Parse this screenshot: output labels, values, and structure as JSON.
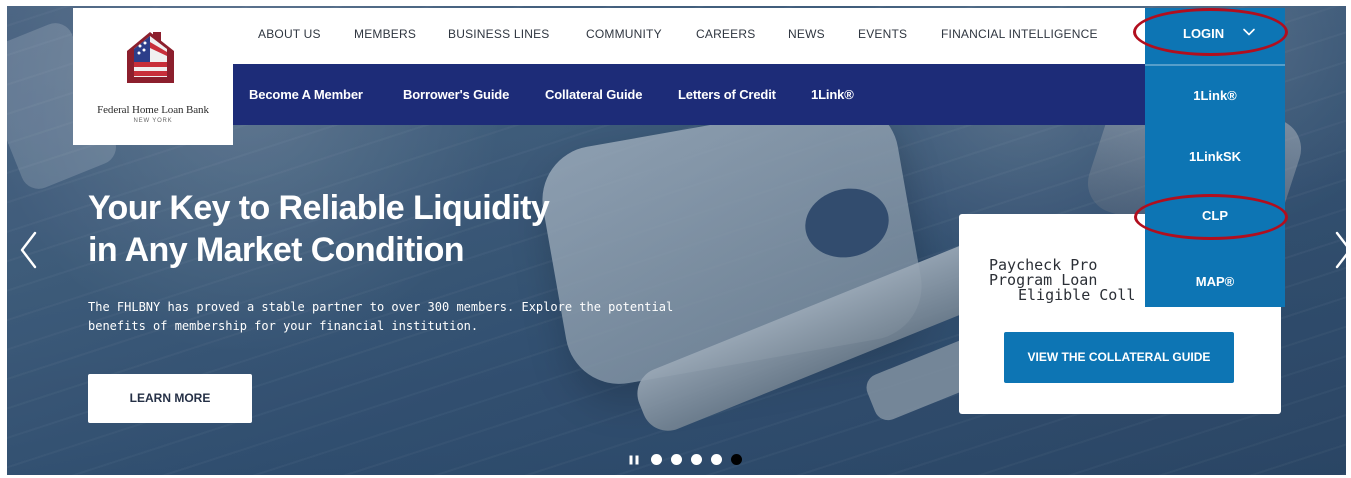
{
  "brand": {
    "name": "Federal Home Loan Bank",
    "subtitle": "NEW YORK"
  },
  "top_nav": [
    "ABOUT US",
    "MEMBERS",
    "BUSINESS LINES",
    "COMMUNITY",
    "CAREERS",
    "NEWS",
    "EVENTS",
    "FINANCIAL INTELLIGENCE"
  ],
  "sub_nav": [
    "Become A Member",
    "Borrower's Guide",
    "Collateral Guide",
    "Letters of Credit",
    "1Link®"
  ],
  "login": {
    "label": "LOGIN",
    "items": [
      "1Link®",
      "1LinkSK",
      "CLP",
      "MAP®"
    ]
  },
  "hero": {
    "headline": "Your Key to Reliable Liquidity\nin Any Market Condition",
    "body": "The FHLBNY has proved a stable partner to over 300 members. Explore the potential\nbenefits of membership for your financial institution.",
    "cta": "LEARN MORE"
  },
  "promo": {
    "title_lines": [
      "Paycheck Pro",
      "Program Loan",
      "Eligible Coll"
    ],
    "button": "VIEW THE COLLATERAL GUIDE"
  },
  "carousel": {
    "total_dots": 5,
    "active_dot": 4
  },
  "colors": {
    "header_blue": "#1d2c78",
    "login_blue": "#0d75b4",
    "annotation_red": "#b10e1e"
  },
  "icons": {
    "logo": "house-flag-logo-icon",
    "chevron": "chevron-down-icon",
    "left_arrow": "chevron-left-icon",
    "right_arrow": "chevron-right-icon",
    "pause": "pause-icon"
  }
}
